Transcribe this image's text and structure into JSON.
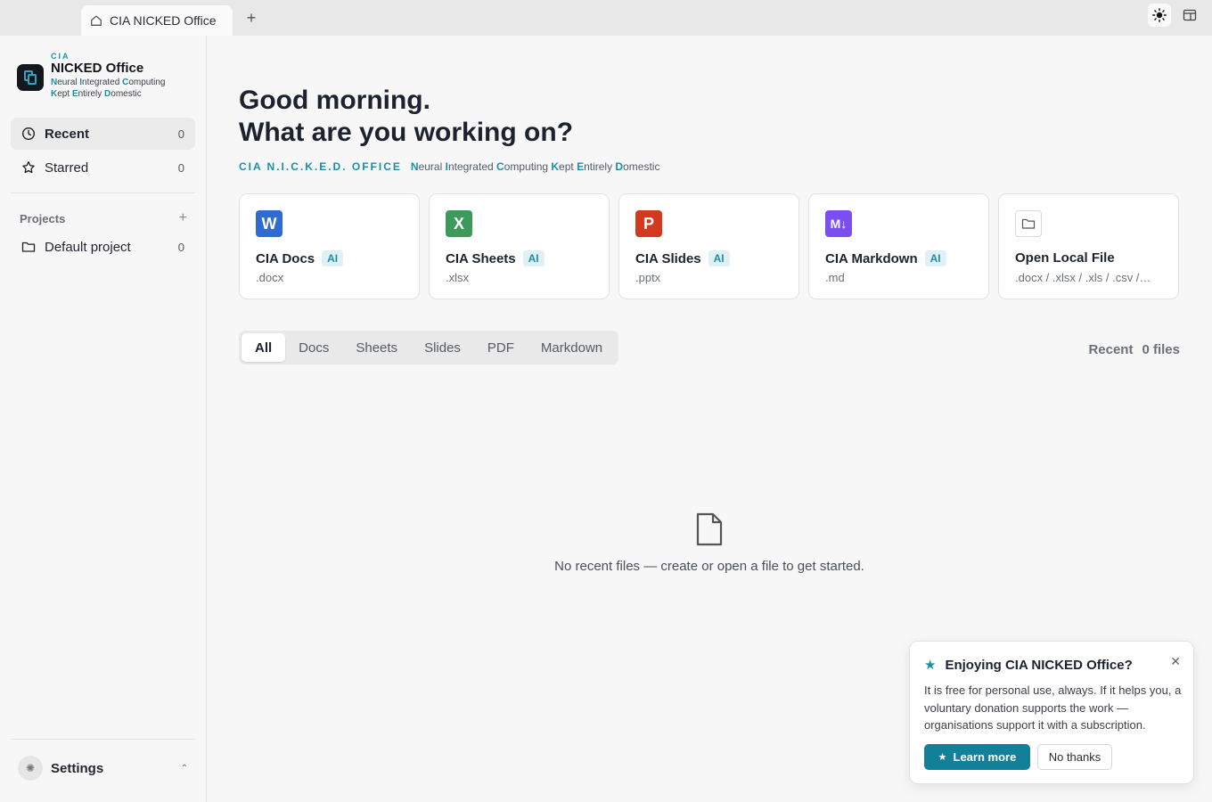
{
  "tabbar": {
    "tab_title": "CIA NICKED Office",
    "new_tab_symbol": "+",
    "icons": [
      "home-icon",
      "sun-icon",
      "sidebar-panel-icon"
    ]
  },
  "brand": {
    "small": "CIA",
    "name": "NICKED Office",
    "line1": [
      "N",
      "eural ",
      "I",
      "ntegrated ",
      "C",
      "omputing"
    ],
    "line2": [
      "K",
      "ept ",
      "E",
      "ntirely ",
      "D",
      "omestic"
    ]
  },
  "sidebar": {
    "nav": [
      {
        "label": "Recent",
        "count": "0",
        "icon": "clock-icon"
      },
      {
        "label": "Starred",
        "count": "0",
        "icon": "star-icon"
      }
    ],
    "projects_label": "Projects",
    "projects": [
      {
        "label": "Default project",
        "count": "0",
        "icon": "folder-icon"
      }
    ],
    "settings_label": "Settings"
  },
  "main": {
    "greeting_line1": "Good morning.",
    "greeting_line2": "What are you working on?",
    "tagline_acronym": "CIA N.I.C.K.E.D. OFFICE",
    "tagline": [
      "N",
      "eural ",
      "I",
      "ntegrated ",
      "C",
      "omputing ",
      "K",
      "ept ",
      "E",
      "ntirely ",
      "D",
      "omestic"
    ],
    "cards": [
      {
        "title": "CIA Docs",
        "ai": "AI",
        "ext": ".docx",
        "badge": "W",
        "color": "#2f6bd0"
      },
      {
        "title": "CIA Sheets",
        "ai": "AI",
        "ext": ".xlsx",
        "badge": "X",
        "color": "#3d9a5b"
      },
      {
        "title": "CIA Slides",
        "ai": "AI",
        "ext": ".pptx",
        "badge": "P",
        "color": "#d2391f"
      },
      {
        "title": "CIA Markdown",
        "ai": "AI",
        "ext": ".md",
        "badge": "M↓",
        "color": "#7b4ef0"
      },
      {
        "title": "Open Local File",
        "ai": "",
        "ext": ".docx / .xlsx / .xls / .csv /…",
        "badge": "folder-icon",
        "color": "#ffffff"
      }
    ],
    "filters": [
      "All",
      "Docs",
      "Sheets",
      "Slides",
      "PDF",
      "Markdown"
    ],
    "active_filter": "All",
    "recent_label": "Recent",
    "recent_count": "0 files",
    "empty_message": "No recent files — create or open a file to get started."
  },
  "toast": {
    "title": "Enjoying CIA NICKED Office?",
    "body": "It is free for personal use, always. If it helps you, a voluntary donation supports the work — organisations support it with a subscription.",
    "learn_more": "Learn more",
    "no_thanks": "No thanks"
  },
  "colors": {
    "accent": "#1a8fa8",
    "button": "#13809a"
  }
}
